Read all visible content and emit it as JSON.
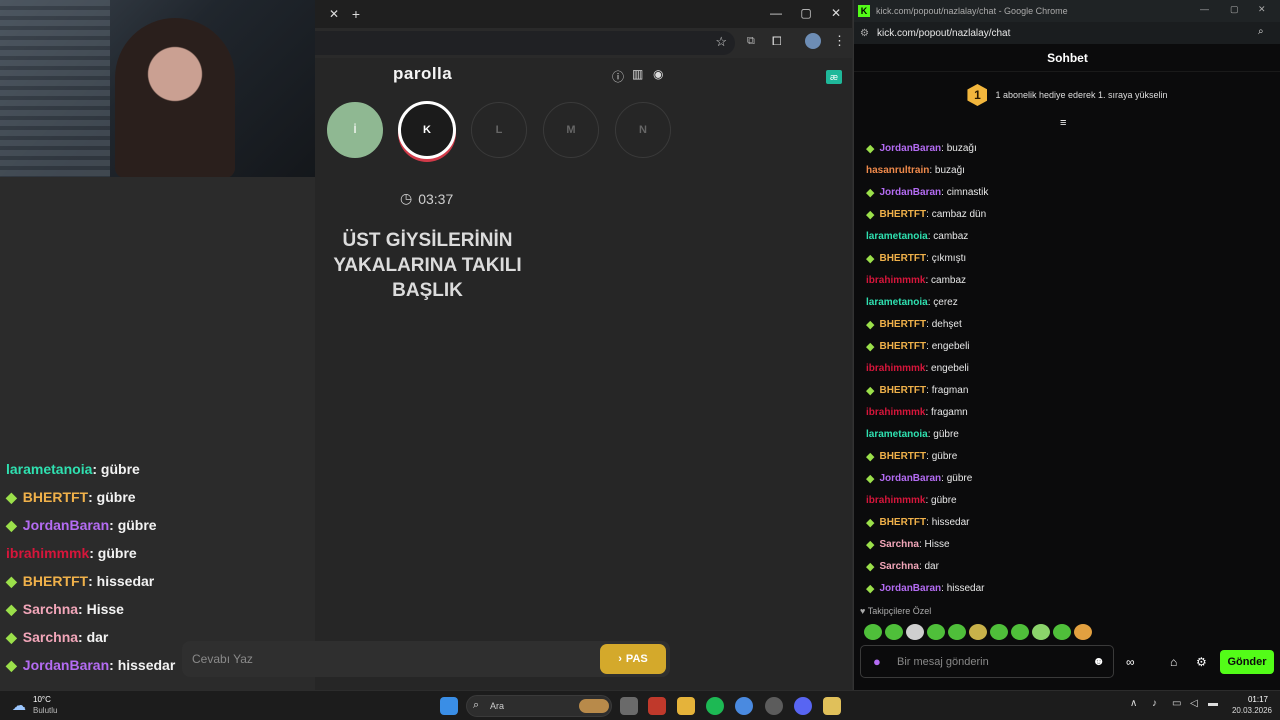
{
  "game": {
    "brand": "parolla",
    "letters": [
      "İ",
      "K",
      "L",
      "M",
      "N"
    ],
    "timer": "03:37",
    "question": "ÜST GİYSİLERİNİN YAKALARINA TAKILI BAŞLIK",
    "answer_placeholder": "Cevabı Yaz",
    "pass_label": "PAS"
  },
  "overlay_chat": [
    {
      "user": "larametanoia",
      "color": "#2fe0b0",
      "badge": false,
      "msg": " : gübre"
    },
    {
      "user": "BHERTFT",
      "color": "#f0b14a",
      "badge": true,
      "msg": " : gübre"
    },
    {
      "user": "JordanBaran",
      "color": "#b46cf3",
      "badge": true,
      "msg": " : gübre"
    },
    {
      "user": "ibrahimmmk",
      "color": "#d6163b",
      "badge": false,
      "msg": " : gübre"
    },
    {
      "user": "BHERTFT",
      "color": "#f0b14a",
      "badge": true,
      "msg": " : hissedar"
    },
    {
      "user": "Sarchna",
      "color": "#f2a6b9",
      "badge": true,
      "msg": " : Hisse"
    },
    {
      "user": "Sarchna",
      "color": "#f2a6b9",
      "badge": true,
      "msg": " : dar"
    },
    {
      "user": "JordanBaran",
      "color": "#b46cf3",
      "badge": true,
      "msg": " : hissedar"
    }
  ],
  "popout": {
    "window_title": "kick.com/popout/nazlalay/chat - Google Chrome",
    "url": "kick.com/popout/nazlalay/chat",
    "header": "Sohbet",
    "gift_text": "1 abonelik hediye ederek 1. sıraya yükselin",
    "gift_number": "1",
    "followers_label": "Takipçilere Özel",
    "input_placeholder": "Bir mesaj gönderin",
    "send_label": "Gönder",
    "messages": [
      {
        "user": "JordanBaran",
        "color": "#b46cf3",
        "badge": true,
        "msg": ": buzağı"
      },
      {
        "user": "hasanrultrain",
        "color": "#f08a4b",
        "badge": false,
        "msg": ": buzağı"
      },
      {
        "user": "JordanBaran",
        "color": "#b46cf3",
        "badge": true,
        "msg": ": cimnastik"
      },
      {
        "user": "BHERTFT",
        "color": "#f0b14a",
        "badge": true,
        "msg": ": cambaz dün"
      },
      {
        "user": "larametanoia",
        "color": "#2fe0b0",
        "badge": false,
        "msg": ": cambaz"
      },
      {
        "user": "BHERTFT",
        "color": "#f0b14a",
        "badge": true,
        "msg": ": çıkmıştı"
      },
      {
        "user": "ibrahimmmk",
        "color": "#d6163b",
        "badge": false,
        "msg": ": cambaz"
      },
      {
        "user": "larametanoia",
        "color": "#2fe0b0",
        "badge": false,
        "msg": ": çerez"
      },
      {
        "user": "BHERTFT",
        "color": "#f0b14a",
        "badge": true,
        "msg": ": dehşet"
      },
      {
        "user": "BHERTFT",
        "color": "#f0b14a",
        "badge": true,
        "msg": ": engebeli"
      },
      {
        "user": "ibrahimmmk",
        "color": "#d6163b",
        "badge": false,
        "msg": ": engebeli"
      },
      {
        "user": "BHERTFT",
        "color": "#f0b14a",
        "badge": true,
        "msg": ": fragman"
      },
      {
        "user": "ibrahimmmk",
        "color": "#d6163b",
        "badge": false,
        "msg": ": fragamn"
      },
      {
        "user": "larametanoia",
        "color": "#2fe0b0",
        "badge": false,
        "msg": ": gübre"
      },
      {
        "user": "BHERTFT",
        "color": "#f0b14a",
        "badge": true,
        "msg": ": gübre"
      },
      {
        "user": "JordanBaran",
        "color": "#b46cf3",
        "badge": true,
        "msg": ": gübre"
      },
      {
        "user": "ibrahimmmk",
        "color": "#d6163b",
        "badge": false,
        "msg": ": gübre"
      },
      {
        "user": "BHERTFT",
        "color": "#f0b14a",
        "badge": true,
        "msg": ": hissedar"
      },
      {
        "user": "Sarchna",
        "color": "#f2a6b9",
        "badge": true,
        "msg": ": Hisse"
      },
      {
        "user": "Sarchna",
        "color": "#f2a6b9",
        "badge": true,
        "msg": ": dar"
      },
      {
        "user": "JordanBaran",
        "color": "#b46cf3",
        "badge": true,
        "msg": ": hissedar"
      }
    ]
  },
  "taskbar": {
    "weather_temp": "10°C",
    "weather_desc": "Bulutlu",
    "search_label": "Ara",
    "time": "01:17",
    "date": "20.03.2026"
  },
  "colors": {
    "kick_green": "#53fc18",
    "pas_gold": "#d4a92b"
  }
}
